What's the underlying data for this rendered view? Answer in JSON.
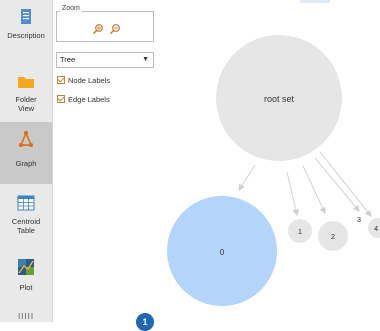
{
  "sidebar": {
    "items": [
      {
        "label": "Description",
        "icon": "description-icon"
      },
      {
        "label": "Folder View",
        "icon": "folder-icon"
      },
      {
        "label": "Graph",
        "icon": "graph-icon"
      },
      {
        "label": "Centroid Table",
        "icon": "table-icon"
      },
      {
        "label": "Plot",
        "icon": "plot-icon"
      }
    ],
    "active": "Graph",
    "more": "IIIII"
  },
  "controls": {
    "zoom_label": "Zoom",
    "layout_select": "Tree",
    "node_labels": {
      "label": "Node Labels",
      "checked": true
    },
    "edge_labels": {
      "label": "Edge Labels",
      "checked": true
    }
  },
  "graph": {
    "root_label": "root set",
    "nodes": [
      "0",
      "1",
      "2",
      "4"
    ],
    "edge_labels": [
      "3"
    ]
  },
  "badge": "1",
  "colors": {
    "root_fill": "#e6e6e6",
    "selected_fill": "#b3d4fb",
    "node_fill": "#e6e6e6",
    "checkbox_accent": "#d07a16",
    "badge": "#1d67b5"
  }
}
